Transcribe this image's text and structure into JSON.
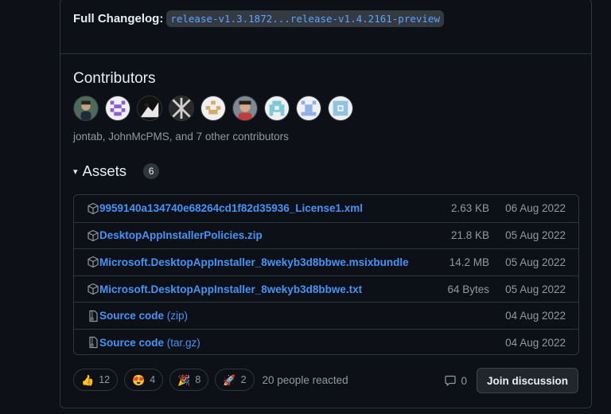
{
  "changelog": {
    "label": "Full Changelog:",
    "range": "release-v1.3.1872...release-v1.4.2161-preview"
  },
  "contributors": {
    "title": "Contributors",
    "summary": "jontab, JohnMcPMS, and 7 other contributors",
    "avatar_count": 9
  },
  "assets": {
    "caret": "▾",
    "title": "Assets",
    "count": "6",
    "items": [
      {
        "icon": "package-icon",
        "name": "9959140a134740e68264cd1f82d35936_License1.xml",
        "suffix": "",
        "size": "2.63 KB",
        "date": "06 Aug 2022"
      },
      {
        "icon": "package-icon",
        "name": "DesktopAppInstallerPolicies.zip",
        "suffix": "",
        "size": "21.8 KB",
        "date": "05 Aug 2022"
      },
      {
        "icon": "package-icon",
        "name": "Microsoft.DesktopAppInstaller_8wekyb3d8bbwe.msixbundle",
        "suffix": "",
        "size": "14.2 MB",
        "date": "05 Aug 2022"
      },
      {
        "icon": "package-icon",
        "name": "Microsoft.DesktopAppInstaller_8wekyb3d8bbwe.txt",
        "suffix": "",
        "size": "64 Bytes",
        "date": "05 Aug 2022"
      },
      {
        "icon": "file-zip-icon",
        "name": "Source code",
        "suffix": "(zip)",
        "size": "",
        "date": "04 Aug 2022"
      },
      {
        "icon": "file-zip-icon",
        "name": "Source code",
        "suffix": "(tar.gz)",
        "size": "",
        "date": "04 Aug 2022"
      }
    ]
  },
  "reactions": {
    "items": [
      {
        "emoji": "👍",
        "count": "12",
        "name": "thumbs-up"
      },
      {
        "emoji": "😍",
        "count": "4",
        "name": "heart-eyes"
      },
      {
        "emoji": "🎉",
        "count": "8",
        "name": "tada"
      },
      {
        "emoji": "🚀",
        "count": "2",
        "name": "rocket"
      }
    ],
    "summary": "20 people reacted"
  },
  "discussion": {
    "comment_count": "0",
    "join_label": "Join discussion"
  },
  "colors": {
    "background": "#0d1117",
    "border": "#30363d",
    "link": "#4493f8",
    "muted": "#9198a1"
  }
}
